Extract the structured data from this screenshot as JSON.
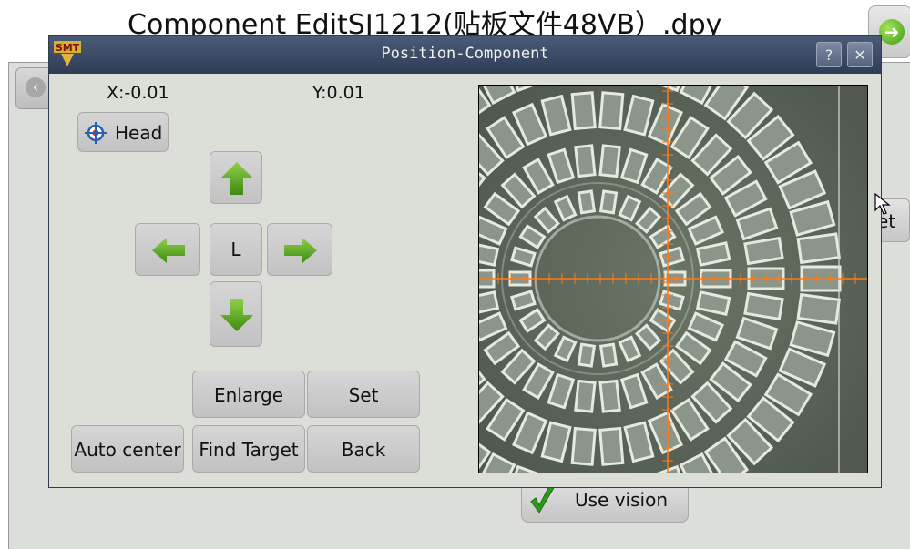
{
  "background": {
    "title": "Component EditSJ1212(贴板文件48VB）.dpy",
    "set_partial": "et",
    "use_vision_label": "Use vision"
  },
  "dialog": {
    "title": "Position-Component",
    "help_label": "?",
    "close_label": "✕",
    "x_readout": "X:-0.01",
    "y_readout": "Y:0.01",
    "head_label": "Head",
    "center_label": "L",
    "enlarge_label": "Enlarge",
    "set_label": "Set",
    "auto_center_label": "Auto center",
    "find_target_label": "Find Target",
    "back_label": "Back"
  },
  "colors": {
    "titlebar": "#3a4862",
    "arrow_green": "#4c9a1c",
    "crosshair": "#ff7a1a"
  },
  "icons": [
    "smt-logo-icon",
    "crosshair-target-icon",
    "up-arrow-icon",
    "left-arrow-icon",
    "right-arrow-icon",
    "down-arrow-icon",
    "checkmark-icon",
    "back-circle-icon",
    "green-back-arrow-icon",
    "mouse-cursor-icon"
  ]
}
